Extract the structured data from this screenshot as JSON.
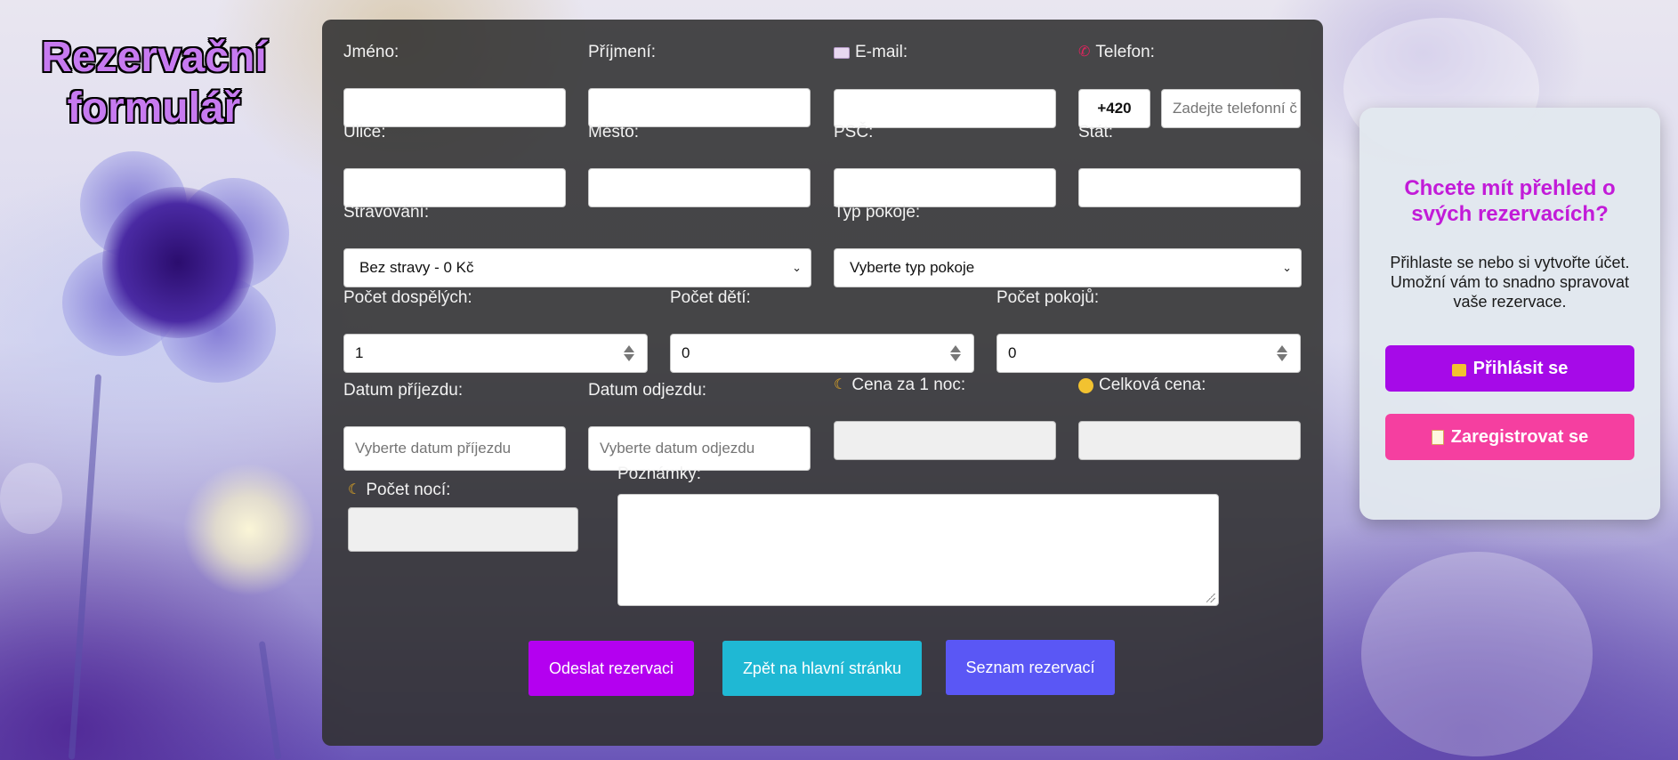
{
  "page": {
    "title": "Rezervační formulář"
  },
  "form": {
    "first_name": {
      "label": "Jméno:",
      "value": ""
    },
    "last_name": {
      "label": "Příjmení:",
      "value": ""
    },
    "email": {
      "label": "E-mail:",
      "icon": "envelope-icon",
      "value": ""
    },
    "phone": {
      "label": "Telefon:",
      "icon": "phone-icon",
      "prefix": "+420",
      "placeholder": "Zadejte telefonní č"
    },
    "street": {
      "label": "Ulice:",
      "value": ""
    },
    "city": {
      "label": "Město:",
      "value": ""
    },
    "zip": {
      "label": "PSČ:",
      "value": ""
    },
    "country": {
      "label": "Stát:",
      "value": ""
    },
    "meals": {
      "label": "Stravování:",
      "selected": "Bez stravy - 0 Kč"
    },
    "room_type": {
      "label": "Typ pokoje:",
      "selected": "Vyberte typ pokoje"
    },
    "adults": {
      "label": "Počet dospělých:",
      "value": "1"
    },
    "children": {
      "label": "Počet dětí:",
      "value": "0"
    },
    "rooms": {
      "label": "Počet pokojů:",
      "value": "0"
    },
    "arrival": {
      "label": "Datum příjezdu:",
      "placeholder": "Vyberte datum příjezdu"
    },
    "departure": {
      "label": "Datum odjezdu:",
      "placeholder": "Vyberte datum odjezdu"
    },
    "price_per_night": {
      "label": "Cena za 1 noc:",
      "icon": "moon-icon",
      "value": ""
    },
    "total_price": {
      "label": "Celková cena:",
      "icon": "money-face-icon",
      "value": ""
    },
    "nights": {
      "label": "Počet nocí:",
      "icon": "moon-icon",
      "value": ""
    },
    "notes": {
      "label": "Poznámky:",
      "value": ""
    }
  },
  "buttons": {
    "submit": "Odeslat rezervaci",
    "back": "Zpět na hlavní stránku",
    "list": "Seznam rezervací"
  },
  "side_card": {
    "heading": "Chcete mít přehled o svých rezervacích?",
    "text": "Přihlaste se nebo si vytvořte účet. Umožní vám to snadno spravovat vaše rezervace.",
    "login_label": "Přihlásit se",
    "login_icon": "lock-icon",
    "register_label": "Zaregistrovat se",
    "register_icon": "memo-icon"
  },
  "colors": {
    "panel_bg": "#303030",
    "submit_btn": "#b400f0",
    "back_btn": "#1fb8d4",
    "list_btn": "#5a57f5",
    "login_btn": "#a60ae8",
    "register_btn": "#f53fa0",
    "heading_accent": "#c21bd8"
  }
}
